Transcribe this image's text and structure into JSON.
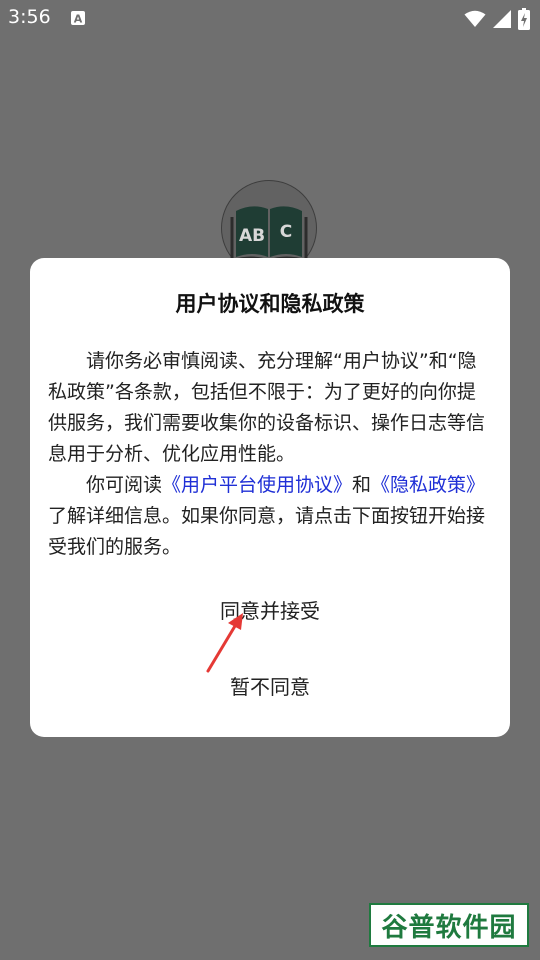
{
  "status_bar": {
    "time": "3:56",
    "icons": [
      "text-notification-icon",
      "wifi-icon",
      "signal-icon",
      "battery-charging-icon"
    ]
  },
  "app": {
    "logo_icon": "abc-book-icon",
    "logo_text": "AB C"
  },
  "dialog": {
    "title": "用户协议和隐私政策",
    "paragraph1": "请你务必审慎阅读、充分理解“用户协议”和“隐私政策”各条款，包括但不限于：为了更好的向你提供服务，我们需要收集你的设备标识、操作日志等信息用于分析、优化应用性能。",
    "paragraph2_prefix": "你可阅读",
    "link_user_agreement": "《用户平台使用协议》",
    "paragraph2_and": "和",
    "link_privacy_policy": "《隐私政策》",
    "paragraph2_suffix": "了解详细信息。如果你同意，请点击下面按钮开始接受我们的服务。",
    "agree_label": "同意并接受",
    "disagree_label": "暂不同意"
  },
  "annotation": {
    "arrow_color": "#e53935"
  },
  "watermark": {
    "text": "谷普软件园",
    "color": "#1f7a3f"
  }
}
